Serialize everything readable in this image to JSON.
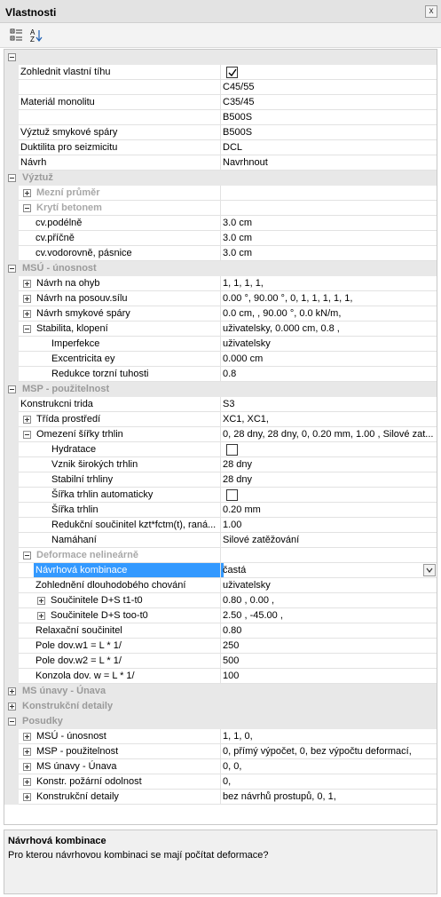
{
  "window": {
    "title": "Vlastnosti",
    "close": "x"
  },
  "toolbar": {
    "categorized_icon": "categorized-icon",
    "sort_icon": "sort-az-icon",
    "sort_label_top": "A",
    "sort_label_bottom": "Z"
  },
  "rows": [
    {
      "kind": "cat",
      "level": 0,
      "exp": "minus",
      "name": ""
    },
    {
      "kind": "prop",
      "level": 1,
      "name": "Zohlednit vlastní tíhu",
      "value": "",
      "check": "checked"
    },
    {
      "kind": "prop",
      "level": 1,
      "name": "",
      "value": "C45/55"
    },
    {
      "kind": "prop",
      "level": 1,
      "name": "Materiál monolitu",
      "value": "C35/45"
    },
    {
      "kind": "prop",
      "level": 1,
      "name": "",
      "value": "B500S"
    },
    {
      "kind": "prop",
      "level": 1,
      "name": "Výztuž smykové spáry",
      "value": "B500S"
    },
    {
      "kind": "prop",
      "level": 1,
      "name": "Duktilita pro seizmicitu",
      "value": "DCL"
    },
    {
      "kind": "prop",
      "level": 1,
      "name": "Návrh",
      "value": "Navrhnout"
    },
    {
      "kind": "cat",
      "level": 0,
      "exp": "minus",
      "name": "Výztuž"
    },
    {
      "kind": "subcat",
      "level": 1,
      "exp": "plus",
      "name": "Mezní průměr"
    },
    {
      "kind": "subcat",
      "level": 1,
      "exp": "minus",
      "name": "Krytí betonem"
    },
    {
      "kind": "prop",
      "level": 2,
      "name": "cv.podélně",
      "value": "3.0 cm"
    },
    {
      "kind": "prop",
      "level": 2,
      "name": "cv.příčně",
      "value": "3.0 cm"
    },
    {
      "kind": "prop",
      "level": 2,
      "name": "cv.vodorovně, pásnice",
      "value": "3.0 cm"
    },
    {
      "kind": "cat",
      "level": 0,
      "exp": "minus",
      "name": "MSÚ - únosnost"
    },
    {
      "kind": "prop",
      "level": 1,
      "exp": "plus",
      "name": "Návrh na ohyb",
      "value": "1, 1, 1, 1,"
    },
    {
      "kind": "prop",
      "level": 1,
      "exp": "plus",
      "name": "Návrh na posouv.sílu",
      "value": "0.00 °, 90.00 °, 0, 1, 1, 1, 1, 1,"
    },
    {
      "kind": "prop",
      "level": 1,
      "exp": "plus",
      "name": "Návrh smykové spáry",
      "value": "0.0 cm, , 90.00 °, 0.0 kN/m,"
    },
    {
      "kind": "prop",
      "level": 1,
      "exp": "minus",
      "name": "Stabilita, klopení",
      "value": "uživatelsky, 0.000 cm, 0.8 ,"
    },
    {
      "kind": "prop",
      "level": 3,
      "name": "Imperfekce",
      "value": "uživatelsky"
    },
    {
      "kind": "prop",
      "level": 3,
      "name": "Excentricita ey",
      "value": "0.000 cm"
    },
    {
      "kind": "prop",
      "level": 3,
      "name": "Redukce torzní tuhosti",
      "value": "0.8"
    },
    {
      "kind": "cat",
      "level": 0,
      "exp": "minus",
      "name": "MSP - použitelnost"
    },
    {
      "kind": "prop",
      "level": 1,
      "name": "Konstrukcni trida",
      "value": "S3"
    },
    {
      "kind": "prop",
      "level": 1,
      "exp": "plus",
      "name": "Třída prostředí",
      "value": "XC1, XC1,"
    },
    {
      "kind": "prop",
      "level": 1,
      "exp": "minus",
      "name": "Omezení šířky trhlin",
      "value": "0, 28 dny, 28 dny, 0, 0.20 mm, 1.00 , Silové zat..."
    },
    {
      "kind": "prop",
      "level": 3,
      "name": "Hydratace",
      "value": "",
      "check": "unchecked"
    },
    {
      "kind": "prop",
      "level": 3,
      "name": "Vznik širokých trhlin",
      "value": "28 dny"
    },
    {
      "kind": "prop",
      "level": 3,
      "name": "Stabilní trhliny",
      "value": "28 dny"
    },
    {
      "kind": "prop",
      "level": 3,
      "name": "Šířka trhlin automaticky",
      "value": "",
      "check": "unchecked"
    },
    {
      "kind": "prop",
      "level": 3,
      "name": "Šířka trhlin",
      "value": "0.20 mm"
    },
    {
      "kind": "prop",
      "level": 3,
      "name": "Redukční součinitel kzt*fctm(t), raná...",
      "value": "1.00"
    },
    {
      "kind": "prop",
      "level": 3,
      "name": "Namáhaní",
      "value": "Silové zatěžování"
    },
    {
      "kind": "subcat",
      "level": 1,
      "exp": "minus",
      "name": "Deformace nelineárně"
    },
    {
      "kind": "prop",
      "level": 2,
      "name": "Návrhová kombinace",
      "value": "častá",
      "selected": true
    },
    {
      "kind": "prop",
      "level": 2,
      "name": "Zohlednění dlouhodobého chování",
      "value": "uživatelsky"
    },
    {
      "kind": "prop",
      "level": 2,
      "exp": "plus",
      "name": "Součinitele D+S t1-t0",
      "value": "0.80 , 0.00 ,"
    },
    {
      "kind": "prop",
      "level": 2,
      "exp": "plus",
      "name": "Součinitele D+S too-t0",
      "value": "2.50 , -45.00 ,"
    },
    {
      "kind": "prop",
      "level": 2,
      "name": "Relaxační součinitel",
      "value": "0.80"
    },
    {
      "kind": "prop",
      "level": 2,
      "name": "Pole dov.w1 = L * 1/",
      "value": "250"
    },
    {
      "kind": "prop",
      "level": 2,
      "name": "Pole dov.w2 = L * 1/",
      "value": "500"
    },
    {
      "kind": "prop",
      "level": 2,
      "name": "Konzola dov. w = L * 1/",
      "value": "100"
    },
    {
      "kind": "cat",
      "level": 0,
      "exp": "plus",
      "name": "MS únavy - Únava"
    },
    {
      "kind": "cat",
      "level": 0,
      "exp": "plus",
      "name": "Konstrukční detaily"
    },
    {
      "kind": "cat",
      "level": 0,
      "exp": "minus",
      "name": "Posudky"
    },
    {
      "kind": "prop",
      "level": 1,
      "exp": "plus",
      "name": "MSÚ - únosnost",
      "value": "1, 1, 0,"
    },
    {
      "kind": "prop",
      "level": 1,
      "exp": "plus",
      "name": "MSP - použitelnost",
      "value": "0, přímý výpočet, 0, bez výpočtu deformací,"
    },
    {
      "kind": "prop",
      "level": 1,
      "exp": "plus",
      "name": "MS únavy - Únava",
      "value": "0, 0,"
    },
    {
      "kind": "prop",
      "level": 1,
      "exp": "plus",
      "name": "Konstr. požární odolnost",
      "value": "0,"
    },
    {
      "kind": "prop",
      "level": 1,
      "exp": "plus",
      "name": "Konstrukční detaily",
      "value": "bez návrhů prostupů, 0, 1,"
    }
  ],
  "description": {
    "title": "Návrhová kombinace",
    "text": "Pro kterou návrhovou kombinaci se mají počítat deformace?"
  }
}
